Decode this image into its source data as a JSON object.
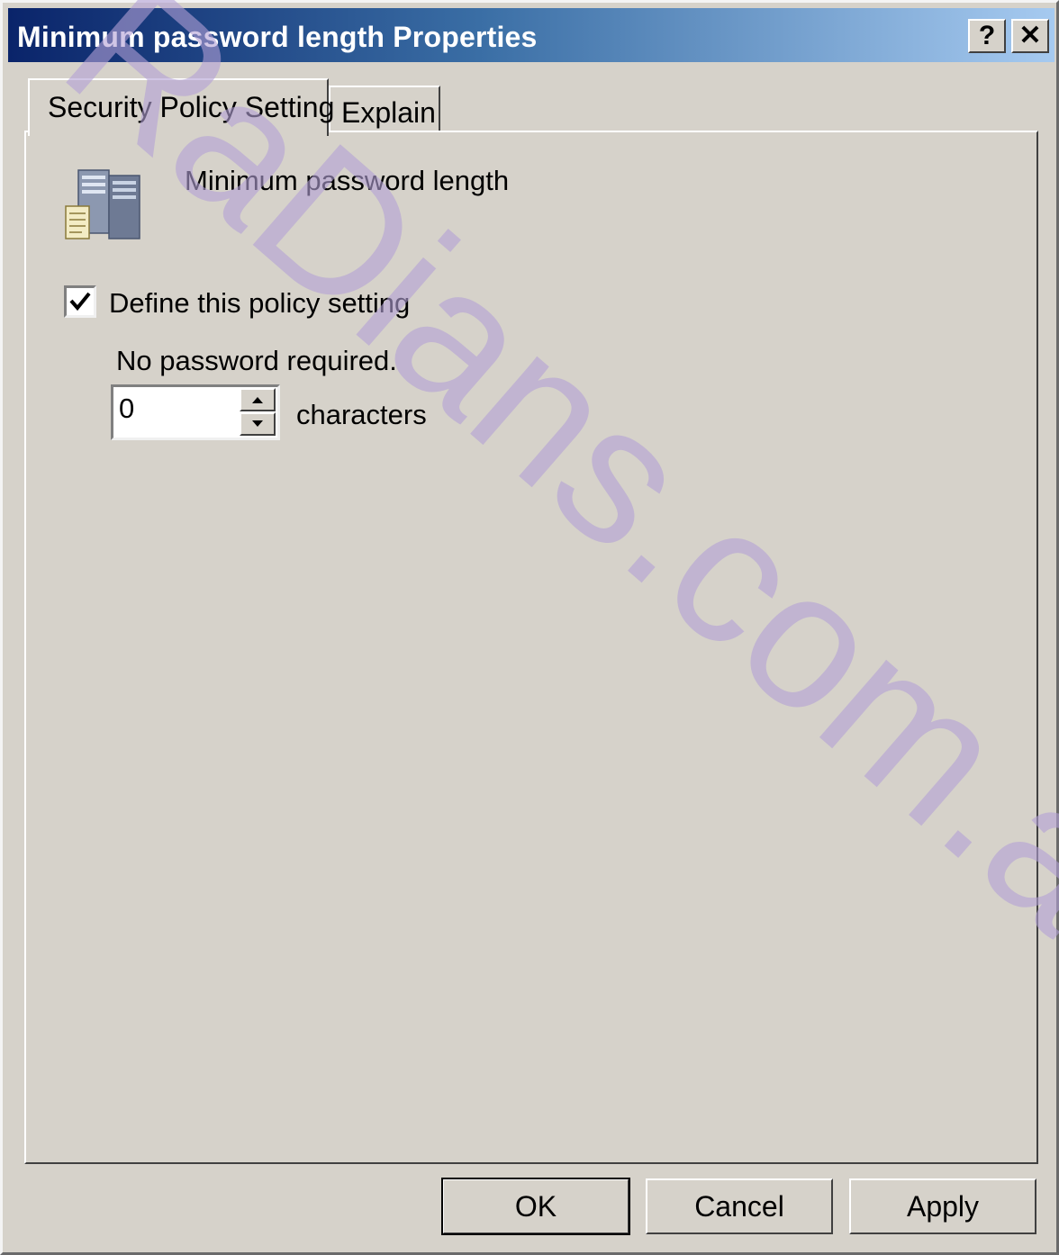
{
  "window": {
    "title": "Minimum password length Properties",
    "help_glyph": "?",
    "close_glyph": "✕"
  },
  "tabs": [
    {
      "label": "Security Policy Setting",
      "active": true
    },
    {
      "label": "Explain",
      "active": false
    }
  ],
  "policy": {
    "name": "Minimum password length",
    "icon": "server-policy-icon",
    "define_checkbox": {
      "label": "Define this policy setting",
      "checked": true
    },
    "status_text": "No password required.",
    "length_value": "0",
    "unit_label": "characters"
  },
  "buttons": {
    "ok": "OK",
    "cancel": "Cancel",
    "apply": "Apply"
  },
  "watermark_text": "RaDians.com.ar",
  "colors": {
    "title_start": "#0a246a",
    "title_end": "#a6caf0",
    "dialog_bg": "#d6d2ca",
    "watermark": "#b3a0d6"
  }
}
